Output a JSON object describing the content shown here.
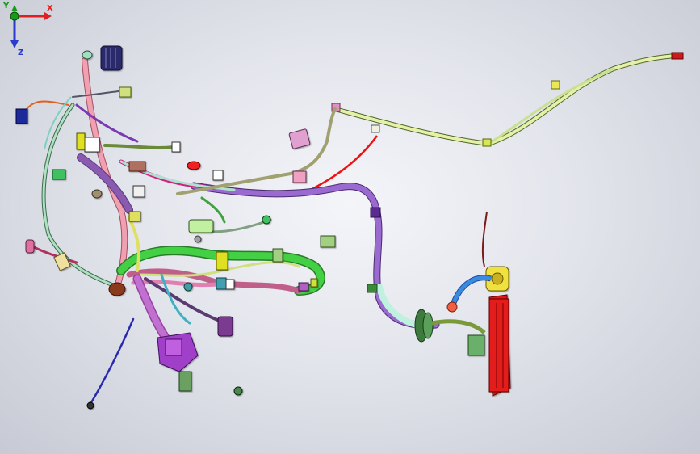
{
  "viewport": {
    "background_top": "#f4f5f9",
    "background_bottom": "#c7cad4"
  },
  "model": {
    "description_components": [
      "wire-harness"
    ]
  },
  "triad": {
    "x_label": "X",
    "y_label": "Y",
    "z_label": "Z",
    "x_color": "#e02020",
    "y_color": "#1a9a1a",
    "z_color": "#2a3acc"
  }
}
